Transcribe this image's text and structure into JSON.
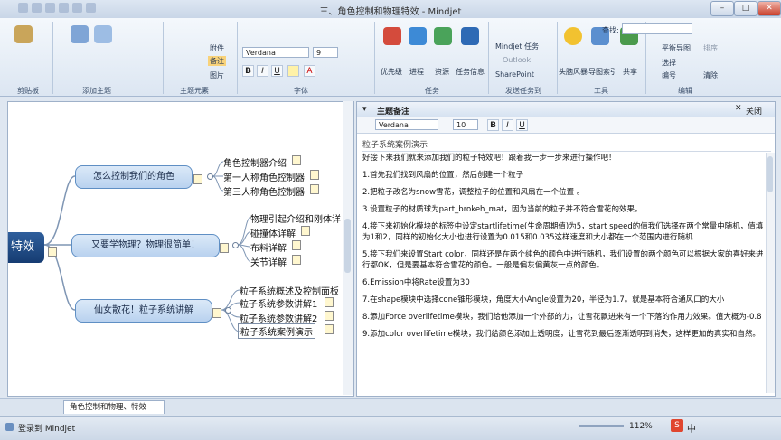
{
  "window": {
    "title": "三、角色控制和物理特效 - Mindjet",
    "minimize": "–",
    "maximize": "□",
    "close": "✕"
  },
  "ribbon": {
    "groups": {
      "clipboard": "剪贴板",
      "add_topic": "添加主题",
      "topic_elements": "主题元素",
      "font": "字体",
      "tasks": "任务",
      "send_tasks": "发送任务到",
      "tools": "工具",
      "edit": "编辑"
    },
    "attachment": "附件",
    "notes": "备注",
    "image": "图片",
    "font_name": "Verdana",
    "font_size": "9",
    "bold": "B",
    "italic": "I",
    "underline": "U",
    "priority": "优先级",
    "progress": "进程",
    "resource": "资源",
    "task_info": "任务信息",
    "mindjet_tasks": "Mindjet 任务",
    "outlook": "Outlook",
    "sharepoint": "SharePoint",
    "brainstorm": "头脑风暴",
    "map_index": "导图索引",
    "share": "共享",
    "find_label": "查找:",
    "balance_map": "平衡导图",
    "sort": "排序",
    "select": "选择",
    "numbering": "编号",
    "clear": "清除"
  },
  "mindmap": {
    "root": "特效",
    "topics": [
      {
        "label": "怎么控制我们的角色",
        "subs": [
          "角色控制器介绍",
          "第一人称角色控制器",
          "第三人称角色控制器"
        ]
      },
      {
        "label": "又要学物理？物理很简单！",
        "subs": [
          "物理引起介绍和刚体详",
          "碰撞体详解",
          "布料详解",
          "关节详解"
        ]
      },
      {
        "label": "仙女散花！粒子系统讲解",
        "subs": [
          "粒子系统概述及控制面板",
          "粒子系统参数讲解1",
          "粒子系统参数讲解2",
          "粒子系统案例演示"
        ]
      }
    ]
  },
  "notes_panel": {
    "title": "主题备注",
    "close": "关闭",
    "font_name": "Verdana",
    "font_size": "10",
    "topic": "粒子系统案例演示",
    "paragraphs": [
      "好接下来我们就来添加我们的粒子特效吧！跟着我一步一步来进行操作吧！",
      "1.首先我们找到风扇的位置，然后创建一个粒子",
      "2.把粒子改名为snow雪花，调整粒子的位置和风扇在一个位置 。",
      "3.设置粒子的材质球为part_brokeh_mat，因为当前的粒子并不符合雪花的效果。",
      "4.接下来初始化模块的标签中设定startlifetime(生命周期值)为5，start speed的值我们选择在两个常量中随机，值填为1和2，同样的初始化大小也进行设置为0.015和0.035这样速度和大小都在一个范围内进行随机",
      "5.接下我们来设置Start color，同样还是在两个纯色的颜色中进行随机，我们设置的两个颜色可以根据大家的喜好来进行都OK，但是要基本符合雪花的颜色。一般是偏灰偏黄灰一点的颜色。",
      "6.Emission中将Rate设置为30",
      "7.在shape模块中选择cone锥形模块，角度大小Angle设置为20，半径为1.7。就是基本符合通风口的大小",
      "8.添加Force overlifetime模块，我们给他添加一个外部的力，让雪花飘进来有一个下落的作用力效果。值大概为-0.8",
      "9.添加color overlifetime模块，我们给颜色添加上透明度，让雪花到最后逐渐透明到消失，这样更加的真实和自然。"
    ]
  },
  "doc_tab": "角色控制和物理、特效",
  "status": {
    "login": "登录到 Mindjet",
    "zoom": "112%",
    "ime": "中"
  }
}
